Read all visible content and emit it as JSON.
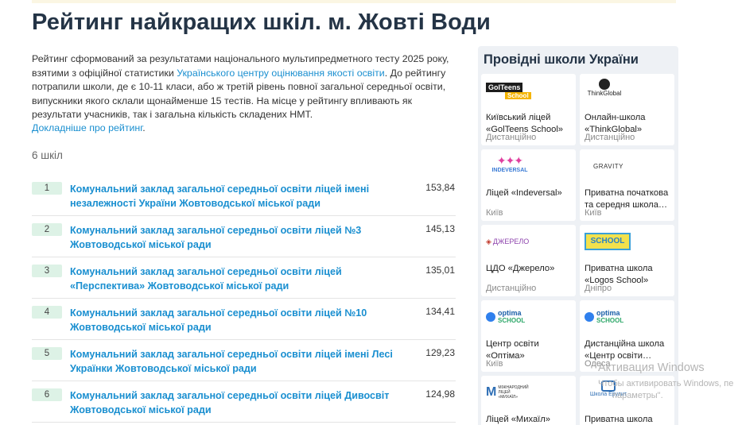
{
  "page": {
    "title": "Рейтинг найкращих шкіл. м. Жовті Води",
    "intro_part1": "Рейтинг сформований за результатами національного мультипредметного тесту 2025 року, взятими з офіційної статистики ",
    "intro_link": "Українського центру оцінювання якості освіти",
    "intro_part2": ". До рейтингу потрапили школи, де є 10-11 класи, або ж третій рівень повної загальної середньої освіти, випускники якого склали щонайменше 15 тестів. На місце у рейтингу впливають як результати учасників, так і загальна кількість складених НМТ.",
    "more_link": "Докладніше про рейтинг",
    "more_link_suffix": ".",
    "count": "6 шкіл"
  },
  "ranking": [
    {
      "rank": "1",
      "name": "Комунальний заклад загальної середньої освіти ліцей імені незалежності України Жовтоводської міської ради",
      "score": "153,84"
    },
    {
      "rank": "2",
      "name": "Комунальний заклад загальної середньої освіти ліцей №3 Жовтоводської міської ради",
      "score": "145,13"
    },
    {
      "rank": "3",
      "name": "Комунальний заклад загальної середньої освіти ліцей «Перспектива» Жовтоводської міської ради",
      "score": "135,01"
    },
    {
      "rank": "4",
      "name": "Комунальний заклад загальної середньої освіти ліцей №10 Жовтоводської міської ради",
      "score": "134,41"
    },
    {
      "rank": "5",
      "name": "Комунальний заклад загальної середньої освіти ліцей імені Лесі Українки Жовтоводської міської ради",
      "score": "129,23"
    },
    {
      "rank": "6",
      "name": "Комунальний заклад загальної середньої освіти ліцей Дивосвіт Жовтоводської міської ради",
      "score": "124,98"
    }
  ],
  "sidebar": {
    "title": "Провідні школи України",
    "schools": [
      {
        "name": "Київський ліцей «GolTeens School»",
        "city": "Дистанційно",
        "logo_text": "GoITeens",
        "logo_sub": "School"
      },
      {
        "name": "Онлайн-школа «ThinkGlobal»",
        "city": "Дистанційно",
        "logo_text": "ThinkGlobal"
      },
      {
        "name": "Ліцей «Indeversal»",
        "city": "Київ",
        "logo_text": "INDEVERSAL"
      },
      {
        "name": "Приватна початкова та середня школа…",
        "city": "Київ",
        "logo_text": "GRAVITY"
      },
      {
        "name": "ЦДО «Джерело»",
        "city": "Дистанційно",
        "logo_text": "ДЖЕРЕЛО"
      },
      {
        "name": "Приватна школа «Logos School»",
        "city": "Дніпро",
        "logo_text": "SCHOOL"
      },
      {
        "name": "Центр освіти «Оптіма»",
        "city": "Київ",
        "logo_text": "optima",
        "logo_sub": "SCHOOL"
      },
      {
        "name": "Дистанційна школа «Центр освіти…",
        "city": "Одеса",
        "logo_text": "optima",
        "logo_sub": "SCHOOL"
      },
      {
        "name": "Ліцей «Михаїл»",
        "city": "",
        "logo_text": "МІЖНАРОДНИЙ ЛІЦЕЙ «МИХАЇЛ»"
      },
      {
        "name": "Приватна школа",
        "city": "",
        "logo_text": "Школа Ерудит"
      }
    ]
  },
  "watermark": {
    "title": "Активация Windows",
    "line1": "Чтобы активировать Windows, пе",
    "line2": "параметры\"."
  },
  "colors": {
    "title": "#243446",
    "link": "#1a8fd0",
    "badge": "#ddf2e6",
    "panel": "#eef1f5"
  }
}
